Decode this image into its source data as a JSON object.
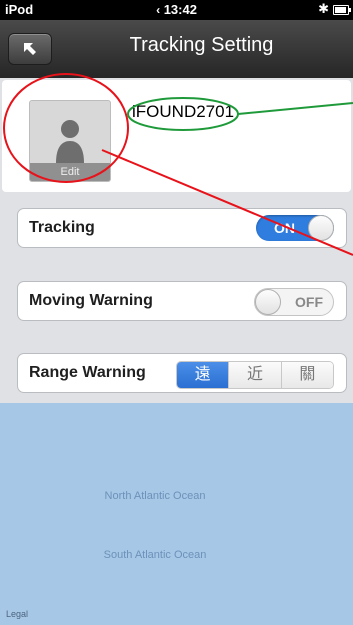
{
  "status_bar": {
    "carrier": "iPod",
    "time": "13:42",
    "bluetooth": "✱"
  },
  "navbar": {
    "title": "Tracking Setting"
  },
  "profile": {
    "edit_label": "Edit",
    "device_name": "iFOUND2701"
  },
  "settings": {
    "tracking": {
      "label": "Tracking",
      "state": "ON"
    },
    "moving_warning": {
      "label": "Moving Warning",
      "state": "OFF"
    },
    "range_warning": {
      "label": "Range Warning",
      "options": [
        "遠",
        "近",
        "關"
      ],
      "selected": "遠"
    }
  },
  "map": {
    "north_ocean": "North Atlantic Ocean",
    "south_ocean": "South Atlantic Ocean",
    "legal": "Legal"
  },
  "colors": {
    "accent": "#2f7ddf",
    "annotation_red": "#e8121a",
    "annotation_green": "#1f9a3a"
  }
}
